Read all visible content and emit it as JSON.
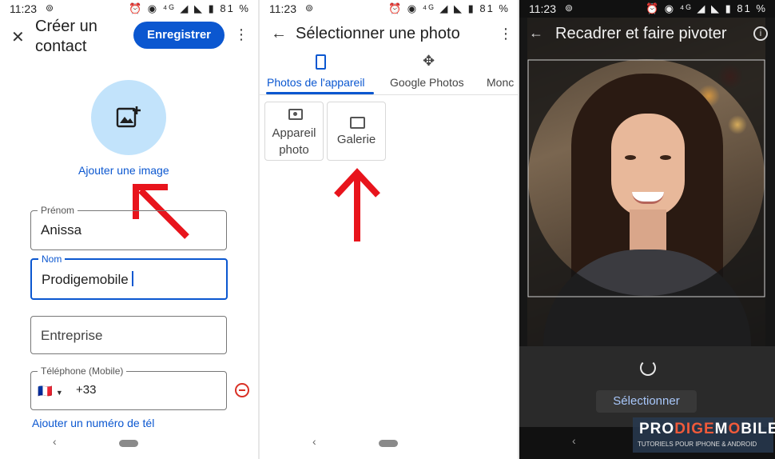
{
  "status": {
    "time": "11:23",
    "battery": "81 %"
  },
  "panel1": {
    "title_line1": "Créer un",
    "title_line2": "contact",
    "save_label": "Enregistrer",
    "add_image_label": "Ajouter une image",
    "fields": {
      "firstname": {
        "label": "Prénom",
        "value": "Anissa"
      },
      "lastname": {
        "label": "Nom",
        "value": "Prodigemobile"
      },
      "company": {
        "placeholder": "Entreprise"
      },
      "phone": {
        "label": "Téléphone (Mobile)",
        "country_code": "+33",
        "flag": "🇫🇷"
      }
    },
    "add_phone_link": "Ajouter un numéro de tél"
  },
  "panel2": {
    "title": "Sélectionner une photo",
    "tabs": [
      {
        "label": "Photos de l'appareil",
        "selected": true
      },
      {
        "label": "Google Photos",
        "selected": false
      },
      {
        "label": "Monc",
        "selected": false
      }
    ],
    "tiles": [
      {
        "line1": "Appareil",
        "line2": "photo"
      },
      {
        "line1": "Galerie"
      }
    ]
  },
  "panel3": {
    "title": "Recadrer et faire pivoter",
    "select_label": "Sélectionner"
  },
  "watermark": {
    "brand_left": "PRO",
    "brand_mid": "DIGE",
    "brand_right": "M",
    "brand_o": "O",
    "brand_end": "BILE",
    "tagline": "TUTORIELS POUR IPHONE & ANDROID"
  },
  "colors": {
    "accent": "#0b57d0",
    "field_active": "#0b57d0",
    "arrow": "#e8141c",
    "remove_icon": "#d93025"
  }
}
